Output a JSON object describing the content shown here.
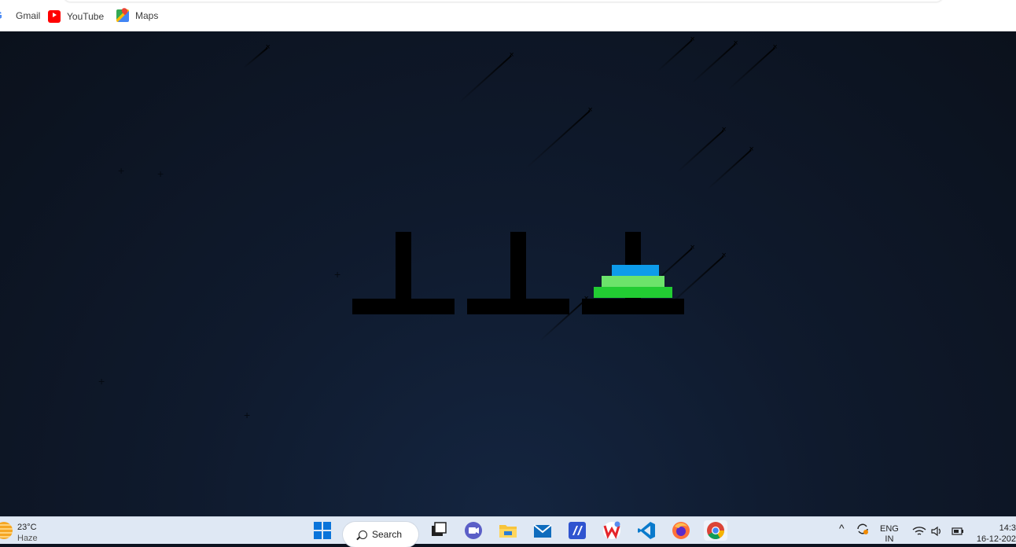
{
  "bookmarks": [
    {
      "label": "Gmail",
      "icon": "google-icon"
    },
    {
      "label": "YouTube",
      "icon": "youtube-icon"
    },
    {
      "label": "Maps",
      "icon": "maps-icon"
    }
  ],
  "game": {
    "towers": [
      {
        "disks": []
      },
      {
        "disks": []
      },
      {
        "disks": [
          {
            "size_rank": 1,
            "color": "#0d9bea"
          },
          {
            "size_rank": 2,
            "color": "#6ce36b"
          },
          {
            "size_rank": 3,
            "color": "#22cc33"
          }
        ]
      }
    ],
    "colors": {
      "tower": "#000000",
      "background": "#0d1320"
    }
  },
  "taskbar": {
    "weather": {
      "temp": "23°C",
      "condition": "Haze"
    },
    "search_label": "Search",
    "language": "ENG",
    "region": "IN",
    "time": "14:3",
    "date": "16-12-202",
    "apps": [
      "windows-start-icon",
      "task-view-icon",
      "meet-icon",
      "file-explorer-icon",
      "mail-icon",
      "visual-studio-icon",
      "wps-office-icon",
      "vscode-icon",
      "firefox-icon",
      "chrome-icon"
    ]
  }
}
